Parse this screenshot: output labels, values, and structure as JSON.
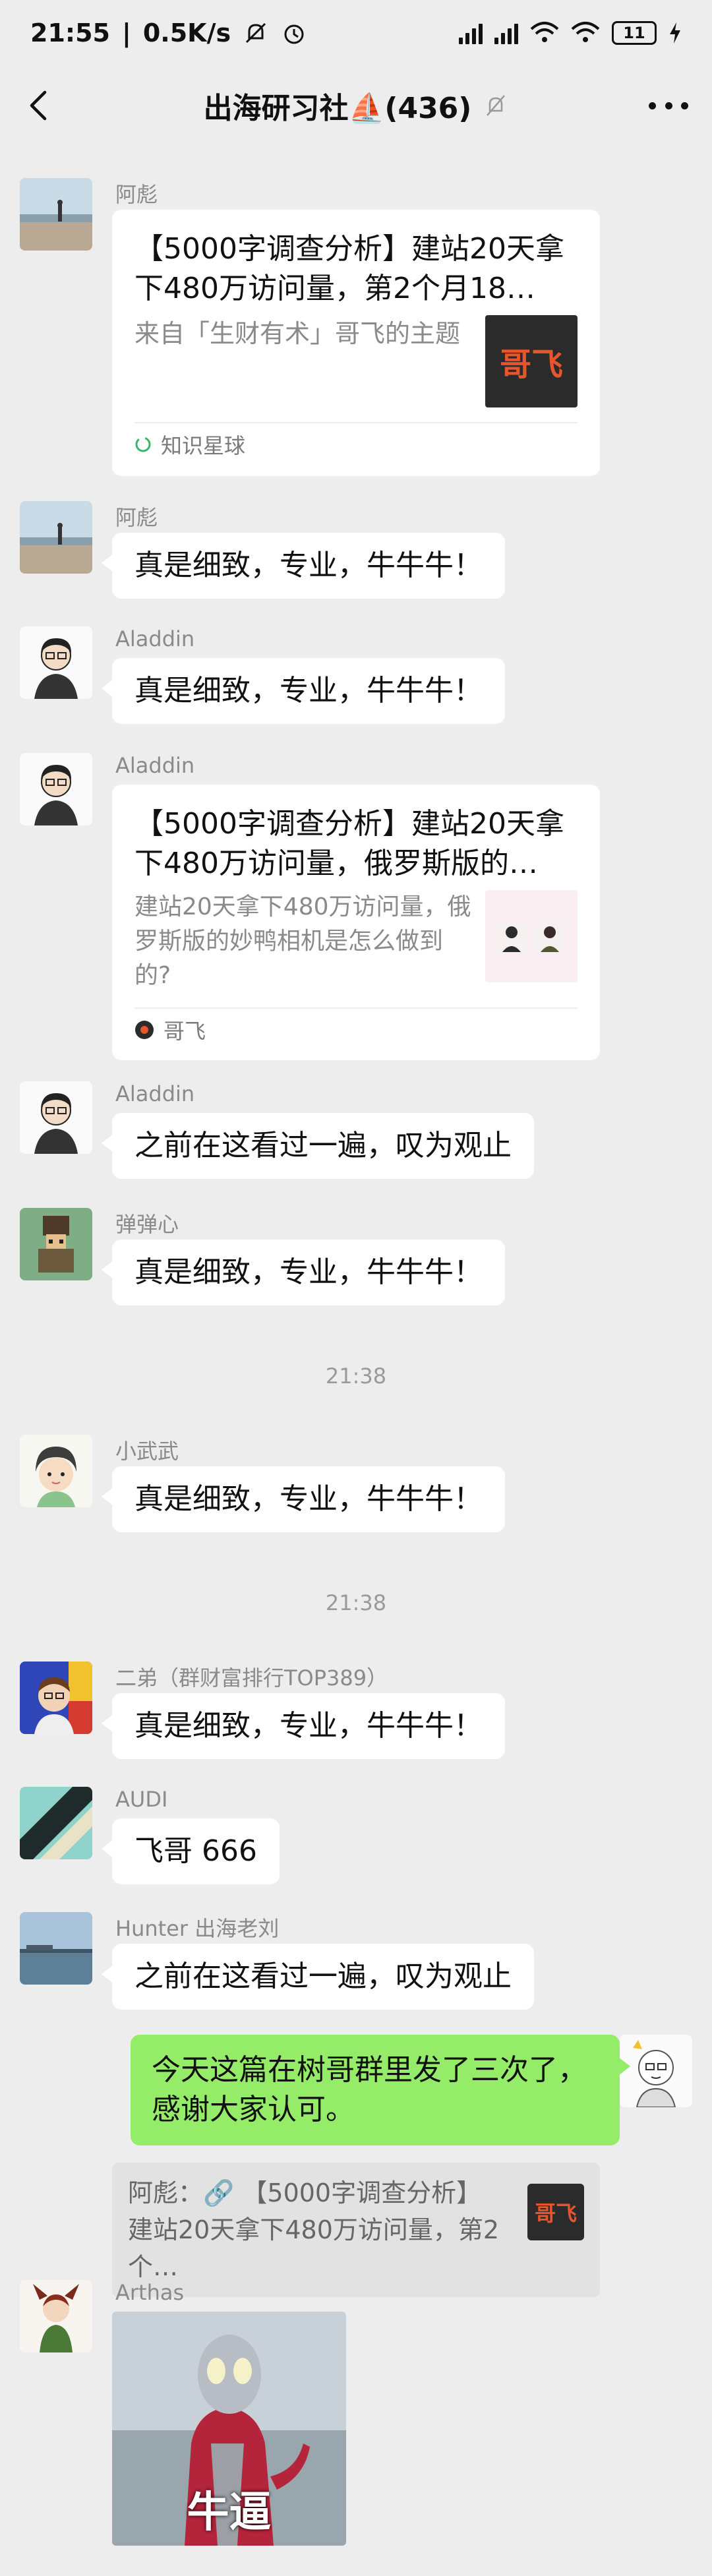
{
  "status_bar": {
    "time": "21:55",
    "speed": "0.5K/s",
    "battery": "11"
  },
  "header": {
    "title": "出海研习社⛵(436)"
  },
  "messages": [
    {
      "sender": "阿彪",
      "card": {
        "title": "【5000字调查分析】建站20天拿下480万访问量，第2个月18…",
        "desc": "来自「生财有术」哥飞的主题",
        "thumb_text": "哥飞",
        "footer": "知识星球"
      }
    },
    {
      "sender": "阿彪",
      "text": "真是细致，专业，牛牛牛！"
    },
    {
      "sender": "Aladdin",
      "text": "真是细致，专业，牛牛牛！"
    },
    {
      "sender": "Aladdin",
      "card": {
        "title": "【5000字调查分析】建站20天拿下480万访问量，俄罗斯版的…",
        "desc": "建站20天拿下480万访问量，俄罗斯版的妙鸭相机是怎么做到的?",
        "footer": "哥飞"
      }
    },
    {
      "sender": "Aladdin",
      "text": "之前在这看过一遍，叹为观止"
    },
    {
      "sender": "弹弹心",
      "text": "真是细致，专业，牛牛牛！"
    },
    {
      "time": "21:38"
    },
    {
      "sender": "小武武",
      "text": "真是细致，专业，牛牛牛！"
    },
    {
      "time": "21:38"
    },
    {
      "sender": "二弟（群财富排行TOP389）",
      "text": "真是细致，专业，牛牛牛！"
    },
    {
      "sender": "AUDI",
      "text": "飞哥 666"
    },
    {
      "sender": "Hunter 出海老刘",
      "text": "之前在这看过一遍，叹为观止"
    },
    {
      "self": true,
      "text": "今天这篇在树哥群里发了三次了，感谢大家认可。",
      "quote": {
        "text": "阿彪：🔗 【5000字调查分析】建站20天拿下480万访问量，第2个…",
        "thumb_text": "哥飞"
      }
    },
    {
      "sender": "Arthas",
      "image_caption": "牛逼"
    }
  ],
  "colors": {
    "background": "#ededed",
    "bubble": "#ffffff",
    "self_bubble": "#95ec69",
    "meta_text": "#8a8a8a",
    "thumb_accent": "#e8542c"
  },
  "icons": [
    "back-arrow-icon",
    "mute-bell-icon",
    "more-dots-icon",
    "signal-icon",
    "wifi-icon",
    "battery-icon",
    "link-icon",
    "knowledge-planet-icon"
  ]
}
